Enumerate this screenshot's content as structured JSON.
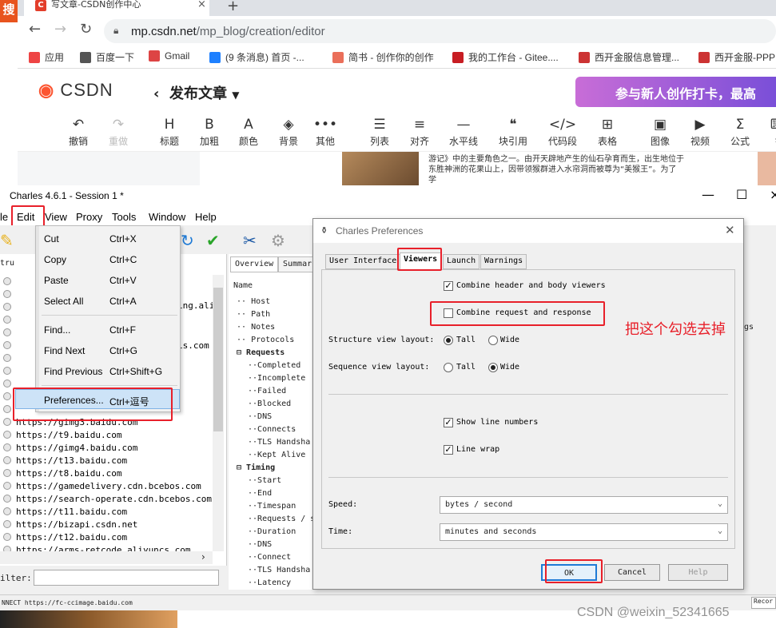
{
  "browser": {
    "search_app_label": "搜",
    "tab_title": "写文章-CSDN创作中心",
    "tab_favicon": "C",
    "tab_close": "×",
    "new_tab": "+",
    "url_host": "mp.csdn.net",
    "url_path": "/mp_blog/creation/editor",
    "bookmarks": [
      {
        "label": "应用",
        "color": "#e44"
      },
      {
        "label": "百度一下",
        "color": "#555"
      },
      {
        "label": "Gmail",
        "color": "#d44"
      },
      {
        "label": "(9 条消息) 首页 -...",
        "color": "#1e80ff"
      },
      {
        "label": "简书 - 创作你的创作",
        "color": "#ea6f5a"
      },
      {
        "label": "我的工作台 - Gitee....",
        "color": "#c71d23"
      },
      {
        "label": "西开金服信息管理...",
        "color": "#c33"
      },
      {
        "label": "西开金服-PPP",
        "color": "#c33"
      }
    ]
  },
  "csdn": {
    "logo": "CSDN",
    "page_title": "发布文章",
    "banner_text": "参与新人创作打卡，最高",
    "toolbar": [
      {
        "icon": "↶",
        "label": "撤销"
      },
      {
        "icon": "↷",
        "label": "重做"
      },
      {
        "icon": "H",
        "label": "标题"
      },
      {
        "icon": "B",
        "label": "加粗"
      },
      {
        "icon": "A",
        "label": "颜色"
      },
      {
        "icon": "◈",
        "label": "背景"
      },
      {
        "icon": "•••",
        "label": "其他"
      },
      {
        "icon": "☰",
        "label": "列表"
      },
      {
        "icon": "≡",
        "label": "对齐"
      },
      {
        "icon": "—",
        "label": "水平线"
      },
      {
        "icon": "❝",
        "label": "块引用"
      },
      {
        "icon": "</>",
        "label": "代码段"
      },
      {
        "icon": "⊞",
        "label": "表格"
      },
      {
        "icon": "▣",
        "label": "图像"
      },
      {
        "icon": "▶",
        "label": "视频"
      },
      {
        "icon": "Σ",
        "label": "公式"
      },
      {
        "icon": "⌨",
        "label": "键"
      }
    ],
    "doc_excerpt": "游记》中的主要角色之一。由开天辟地产生的仙石孕育而生，出生地位于东胜神洲的花果山上，因带领猴群进入水帘洞而被尊为“美猴王”。为了学"
  },
  "charles": {
    "window_title": "Charles 4.6.1 - Session 1 *",
    "menus": [
      "le",
      "Edit",
      "View",
      "Proxy",
      "Tools",
      "Window",
      "Help"
    ],
    "left_header": "tru",
    "urls": [
      "https://gimg3.baidu.com",
      "https://t9.baidu.com",
      "https://gimg4.baidu.com",
      "https://t13.baidu.com",
      "https://t8.baidu.com",
      "https://gamedelivery.cdn.bcebos.com",
      "https://search-operate.cdn.bcebos.com",
      "https://t11.baidu.com",
      "https://bizapi.csdn.net",
      "https://t12.baidu.com",
      "https://arms-retcode.aliyuncs.com"
    ],
    "partial_rows": [
      "ing.ali",
      "is.com"
    ],
    "filter_label": "ilter:",
    "right_tabs": [
      "Overview",
      "Summar"
    ],
    "column_name": "Name",
    "tree": [
      {
        "label": "Host",
        "indent": 0,
        "bold": false
      },
      {
        "label": "Path",
        "indent": 0,
        "bold": false
      },
      {
        "label": "Notes",
        "indent": 0,
        "bold": false
      },
      {
        "label": "Protocols",
        "indent": 0,
        "bold": false
      },
      {
        "label": "Requests",
        "indent": 0,
        "bold": true
      },
      {
        "label": "Completed",
        "indent": 1,
        "bold": false
      },
      {
        "label": "Incomplete",
        "indent": 1,
        "bold": false
      },
      {
        "label": "Failed",
        "indent": 1,
        "bold": false
      },
      {
        "label": "Blocked",
        "indent": 1,
        "bold": false
      },
      {
        "label": "DNS",
        "indent": 1,
        "bold": false
      },
      {
        "label": "Connects",
        "indent": 1,
        "bold": false
      },
      {
        "label": "TLS Handsha",
        "indent": 1,
        "bold": false
      },
      {
        "label": "Kept Alive",
        "indent": 1,
        "bold": false
      },
      {
        "label": "Timing",
        "indent": 0,
        "bold": true
      },
      {
        "label": "Start",
        "indent": 1,
        "bold": false
      },
      {
        "label": "End",
        "indent": 1,
        "bold": false
      },
      {
        "label": "Timespan",
        "indent": 1,
        "bold": false
      },
      {
        "label": "Requests / s",
        "indent": 1,
        "bold": false
      },
      {
        "label": "Duration",
        "indent": 1,
        "bold": false
      },
      {
        "label": "DNS",
        "indent": 1,
        "bold": false
      },
      {
        "label": "Connect",
        "indent": 1,
        "bold": false
      },
      {
        "label": "TLS Handsha",
        "indent": 1,
        "bold": false
      },
      {
        "label": "Latency",
        "indent": 1,
        "bold": false
      }
    ],
    "partial_right": "gs",
    "status_text": "NNECT https://fc-ccimage.baidu.com",
    "record_label": "Recor"
  },
  "edit_menu": {
    "items": [
      {
        "label": "Cut",
        "shortcut": "Ctrl+X"
      },
      {
        "label": "Copy",
        "shortcut": "Ctrl+C"
      },
      {
        "label": "Paste",
        "shortcut": "Ctrl+V"
      },
      {
        "label": "Select All",
        "shortcut": "Ctrl+A"
      },
      {
        "label": "Find...",
        "shortcut": "Ctrl+F"
      },
      {
        "label": "Find Next",
        "shortcut": "Ctrl+G"
      },
      {
        "label": "Find Previous",
        "shortcut": "Ctrl+Shift+G"
      },
      {
        "label": "Preferences...",
        "shortcut": "Ctrl+逗号"
      }
    ]
  },
  "prefs": {
    "title": "Charles Preferences",
    "tabs": [
      "User Interface",
      "Viewers",
      "Launch",
      "Warnings"
    ],
    "active_tab": "Viewers",
    "combine_header_body": {
      "label": "Combine header and body viewers",
      "checked": true
    },
    "combine_req_resp": {
      "label": "Combine request and response",
      "checked": false
    },
    "structure_label": "Structure view layout:",
    "structure_options": [
      "Tall",
      "Wide"
    ],
    "structure_selected": "Tall",
    "sequence_label": "Sequence view layout:",
    "sequence_options": [
      "Tall",
      "Wide"
    ],
    "sequence_selected": "Wide",
    "show_line_numbers": {
      "label": "Show line numbers",
      "checked": true
    },
    "line_wrap": {
      "label": "Line wrap",
      "checked": true
    },
    "speed_label": "Speed:",
    "speed_value": "bytes / second",
    "time_label": "Time:",
    "time_value": "minutes and seconds",
    "ok": "OK",
    "cancel": "Cancel",
    "help": "Help"
  },
  "annotation": {
    "text": "把这个勾选去掉",
    "color": "#e8202a"
  },
  "watermark": "CSDN @weixin_52341665"
}
